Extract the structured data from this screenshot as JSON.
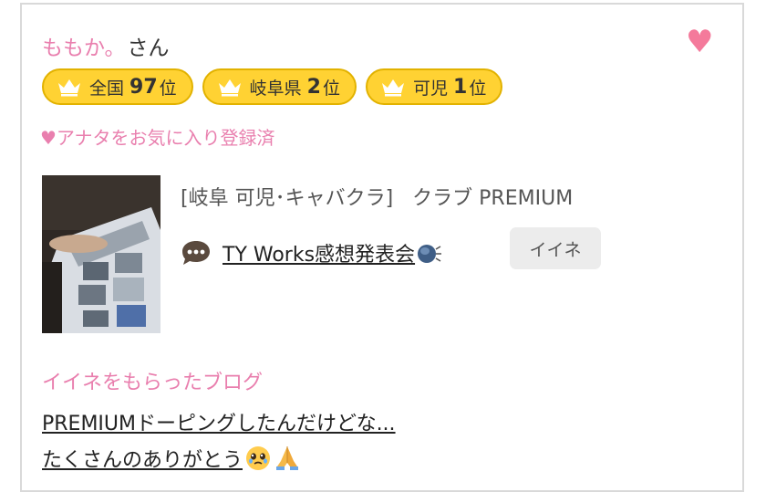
{
  "profile": {
    "name": "ももか。",
    "suffix": "さん",
    "favorite_icon": "heart-icon",
    "favorite_status": "♥アナタをお気に入り登録済"
  },
  "rankings": [
    {
      "label": "全国",
      "rank": "97",
      "unit": "位"
    },
    {
      "label": "岐阜県",
      "rank": "2",
      "unit": "位"
    },
    {
      "label": "可児",
      "rank": "1",
      "unit": "位"
    }
  ],
  "shop": {
    "label": "[岐阜 可児･キャバクラ]",
    "name": "クラブ PREMIUM"
  },
  "blog": {
    "title": "TY Works感想発表会",
    "like_button": "イイネ"
  },
  "liked_blogs": {
    "heading": "イイネをもらったブログ",
    "posts": [
      {
        "title": "PREMIUMドーピングしたんだけどな..."
      },
      {
        "title": "たくさんのありがとう"
      }
    ]
  },
  "colors": {
    "accent_pink": "#e97fae",
    "heart": "#f47a9b",
    "badge_yellow": "#ffd233"
  }
}
